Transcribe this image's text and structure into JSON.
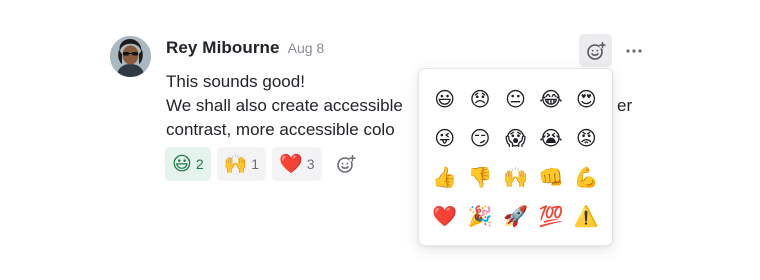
{
  "message": {
    "author": "Rey Mibourne",
    "timestamp": "Aug 8",
    "lines": [
      "This sounds good!",
      "We shall also create accessible",
      "contrast, more accessible colo"
    ],
    "overflow_fragment": "er"
  },
  "reactions": [
    {
      "emoji": "😃",
      "count": "2",
      "mine": true
    },
    {
      "emoji": "🙌",
      "count": "1",
      "mine": false
    },
    {
      "emoji": "❤️",
      "count": "3",
      "mine": false
    }
  ],
  "picker": {
    "emojis": [
      "😃",
      "😞",
      "😐",
      "😂",
      "😍",
      "😜",
      "😏",
      "😱",
      "😭",
      "😡",
      "👍",
      "👎",
      "🙌",
      "👊",
      "💪",
      "❤️",
      "🎉",
      "🚀",
      "💯",
      "⚠️"
    ]
  },
  "icons": {
    "add_reaction": "smiley-plus-icon",
    "more": "more-horizontal-icon"
  },
  "colors": {
    "own_reaction_bg": "#e4f4ec",
    "own_reaction_text": "#1f7a45",
    "reaction_bg": "#f3f3f5"
  }
}
